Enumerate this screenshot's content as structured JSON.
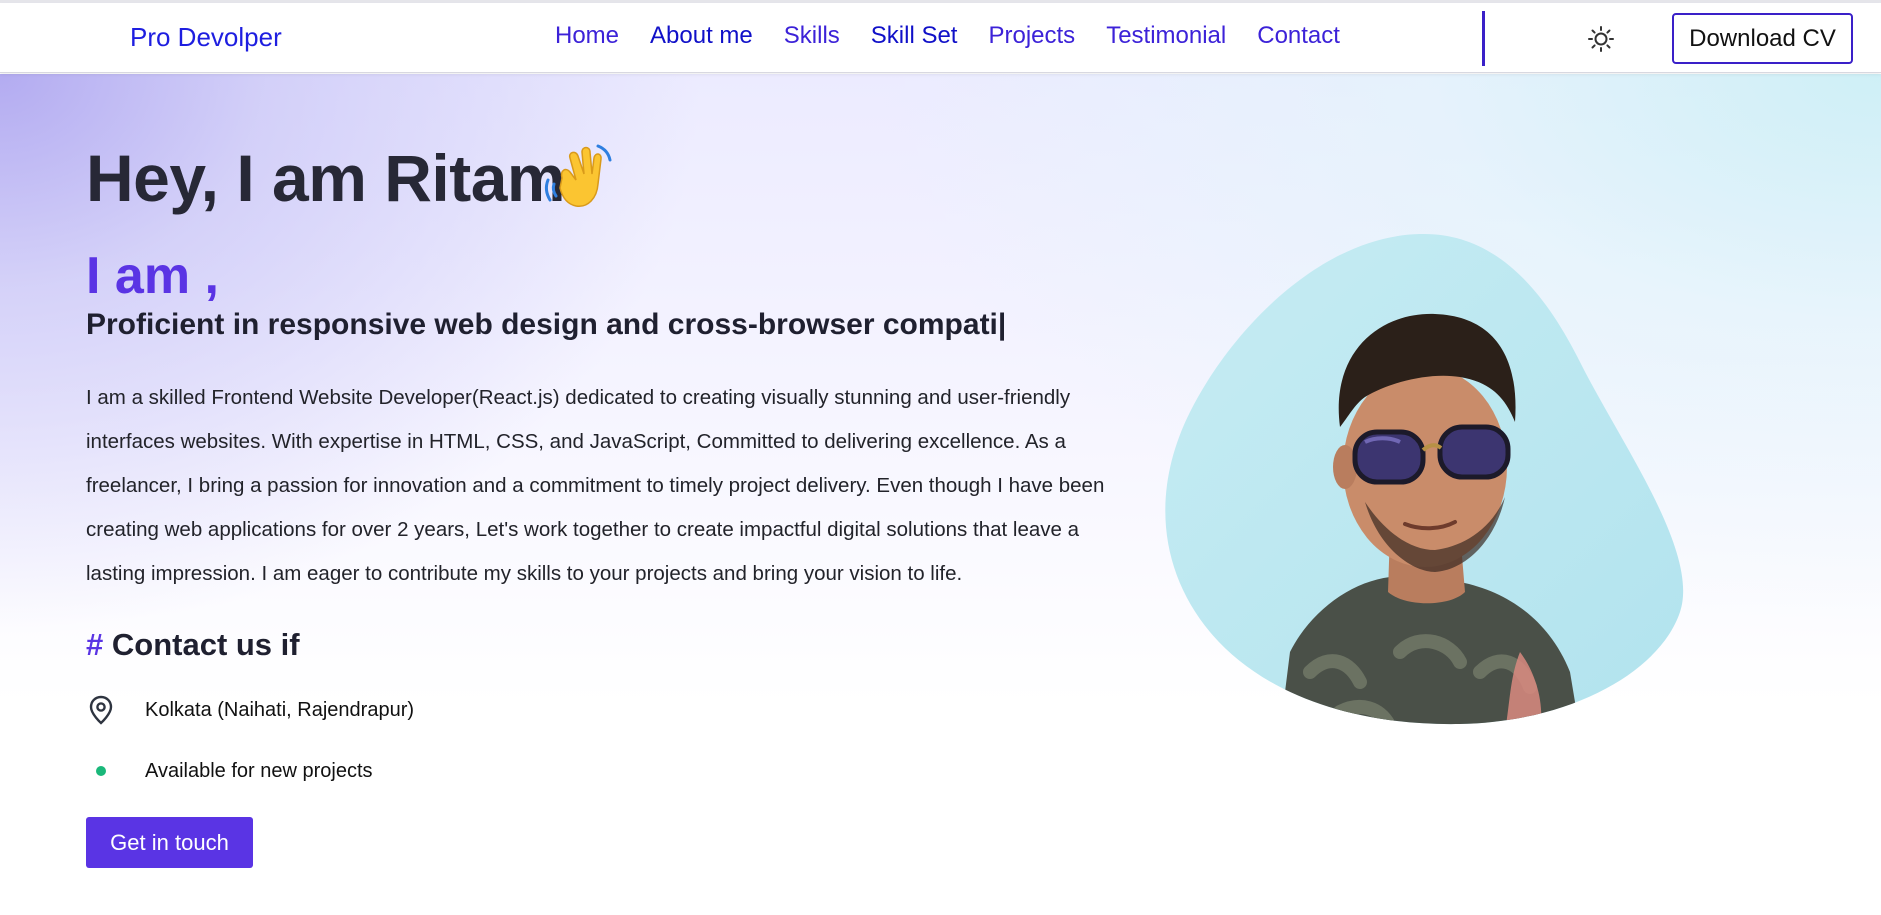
{
  "header": {
    "brand": "Pro Devolper",
    "nav": [
      "Home",
      "About me",
      "Skills",
      "Skill Set",
      "Projects",
      "Testimonial",
      "Contact"
    ],
    "theme_icon": "sun-icon",
    "download_cv": "Download CV"
  },
  "hero": {
    "greeting": "Hey, I am Ritam",
    "greeting_icon": "waving-hand-icon",
    "i_am": "I am ,",
    "typed_text": "Proficient in responsive web design and cross-browser compati|",
    "bio": "I am a skilled Frontend Website Developer(React.js) dedicated to creating visually stunning and user-friendly interfaces websites. With expertise in HTML, CSS, and JavaScript, Committed to delivering excellence. As a freelancer, I bring a passion for innovation and a commitment to timely project delivery. Even though I have been creating web applications for over 2 years, Let's work together to create impactful digital solutions that leave a lasting impression. I am eager to contribute my skills to your projects and bring your vision to life.",
    "contact_hash": "#",
    "contact_title": "Contact us if",
    "location": "Kolkata (Naihati, Rajendrapur)",
    "location_icon": "map-pin-icon",
    "availability": "Available for new projects",
    "availability_color": "#1ab87a",
    "cta": "Get in touch"
  },
  "colors": {
    "accent": "#5a34e4",
    "nav": "#3c22d8",
    "heading": "#272836",
    "blob": "#bde8f0"
  }
}
